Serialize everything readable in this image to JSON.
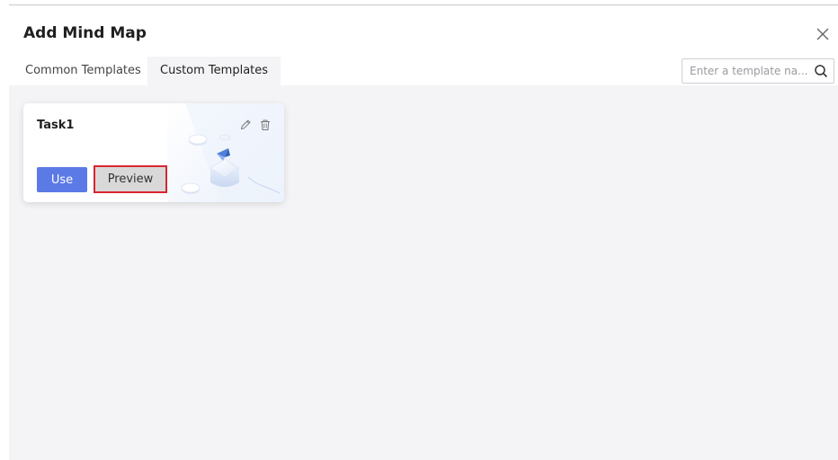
{
  "dialog": {
    "title": "Add Mind Map",
    "close_icon": "close-icon"
  },
  "tabs": [
    {
      "label": "Common Templates",
      "active": false
    },
    {
      "label": "Custom Templates",
      "active": true
    }
  ],
  "search": {
    "placeholder": "Enter a template na...",
    "value": "",
    "icon": "search-icon"
  },
  "templates": [
    {
      "name": "Task1",
      "edit_icon": "edit-icon",
      "delete_icon": "delete-icon",
      "use_label": "Use",
      "preview_label": "Preview"
    }
  ],
  "colors": {
    "primary": "#5b7ae6",
    "content_bg": "#f4f4f6",
    "highlight": "#d9262d"
  }
}
